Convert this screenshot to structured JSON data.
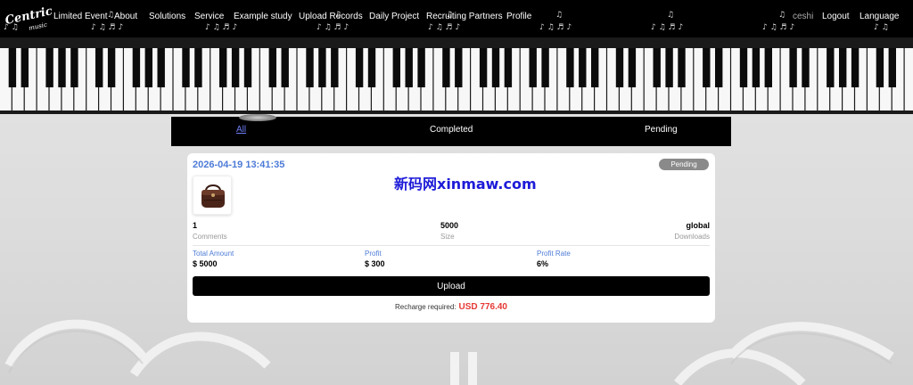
{
  "brand": {
    "logo_text": "Centricity",
    "logo_sub": "music"
  },
  "nav": {
    "items": [
      {
        "label": "Limited Event"
      },
      {
        "label": "About"
      },
      {
        "label": "Solutions"
      },
      {
        "label": "Service"
      },
      {
        "label": "Example study"
      },
      {
        "label": "Upload Records"
      },
      {
        "label": "Daily Project"
      },
      {
        "label": "Recruiting Partners"
      },
      {
        "label": "Profile"
      }
    ],
    "username": "ceshi",
    "logout": "Logout",
    "language": "Language"
  },
  "tabs": [
    {
      "label": "All",
      "active": true
    },
    {
      "label": "Completed",
      "active": false
    },
    {
      "label": "Pending",
      "active": false
    }
  ],
  "order": {
    "date": "2026-04-19 13:41:35",
    "status": "Pending",
    "watermark": "新码网xinmaw.com",
    "stats": [
      {
        "value": "1",
        "label": "Comments"
      },
      {
        "value": "5000",
        "label": "Size"
      },
      {
        "value": "global",
        "label": "Downloads"
      }
    ],
    "amounts": [
      {
        "label": "Total Amount",
        "value": "$ 5000"
      },
      {
        "label": "Profit",
        "value": "$ 300"
      },
      {
        "label": "Profit Rate",
        "value": "6%"
      }
    ],
    "upload_label": "Upload",
    "recharge_label": "Recharge required:",
    "recharge_amount": "USD 776.40"
  },
  "colors": {
    "accent": "#4d7bd6",
    "alert": "#e53935",
    "tab_active": "#6c7cf2"
  },
  "icons": {
    "music_note": "music-note-icon",
    "product": "handbag-image"
  }
}
